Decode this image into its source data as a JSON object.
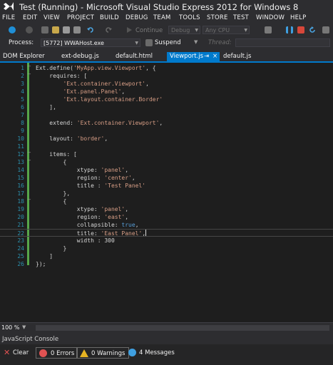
{
  "window": {
    "title": "Test (Running) - Microsoft Visual Studio Express 2012 for Windows 8"
  },
  "menu": [
    "FILE",
    "EDIT",
    "VIEW",
    "PROJECT",
    "BUILD",
    "DEBUG",
    "TEAM",
    "TOOLS",
    "STORE",
    "TEST",
    "WINDOW",
    "HELP"
  ],
  "toolbar": {
    "continue_label": "Continue",
    "config_value": "Debug",
    "platform_value": "Any CPU"
  },
  "debug_bar": {
    "process_label": "Process:",
    "process_value": "[5772] WWAHost.exe",
    "suspend_label": "Suspend",
    "thread_label": "Thread:"
  },
  "tabs": [
    {
      "label": "DOM Explorer"
    },
    {
      "label": "ext-debug.js"
    },
    {
      "label": "default.html"
    },
    {
      "label": "Viewport.js",
      "pin": "⇥",
      "close": "×"
    },
    {
      "label": "default.js"
    }
  ],
  "editor": {
    "lines": [
      {
        "n": "1",
        "text": "Ext.define('MyApp.view.Viewport', {"
      },
      {
        "n": "2",
        "text": "    requires: ["
      },
      {
        "n": "3",
        "text": "        'Ext.container.Viewport',"
      },
      {
        "n": "4",
        "text": "        'Ext.panel.Panel',"
      },
      {
        "n": "5",
        "text": "        'Ext.layout.container.Border'"
      },
      {
        "n": "6",
        "text": "    ],"
      },
      {
        "n": "7",
        "text": ""
      },
      {
        "n": "8",
        "text": "    extend: 'Ext.container.Viewport',"
      },
      {
        "n": "9",
        "text": ""
      },
      {
        "n": "10",
        "text": "    layout: 'border',"
      },
      {
        "n": "11",
        "text": ""
      },
      {
        "n": "12",
        "text": "    items: ["
      },
      {
        "n": "13",
        "text": "        {"
      },
      {
        "n": "14",
        "text": "            xtype: 'panel',"
      },
      {
        "n": "15",
        "text": "            region: 'center',"
      },
      {
        "n": "16",
        "text": "            title : 'Test Panel'"
      },
      {
        "n": "17",
        "text": "        },"
      },
      {
        "n": "18",
        "text": "        {"
      },
      {
        "n": "19",
        "text": "            xtype: 'panel',"
      },
      {
        "n": "20",
        "text": "            region: 'east',"
      },
      {
        "n": "21",
        "text": "            collapsible: true,"
      },
      {
        "n": "22",
        "text": "            title: 'East Panel',"
      },
      {
        "n": "23",
        "text": "            width : 300"
      },
      {
        "n": "24",
        "text": "        }"
      },
      {
        "n": "25",
        "text": "    ]"
      },
      {
        "n": "26",
        "text": "});"
      }
    ]
  },
  "status": {
    "zoom": "100 %"
  },
  "console": {
    "title": "JavaScript Console",
    "clear_label": "Clear",
    "errors_label": "0 Errors",
    "warnings_label": "0 Warnings",
    "messages_label": "4 Messages"
  },
  "colors": {
    "accent": "#007acc",
    "background": "#1e1e1e",
    "chrome": "#2d2d30",
    "line_number": "#2b91af",
    "string": "#d69d85",
    "keyword": "#569cd6",
    "changed_margin": "#57a64a"
  },
  "icons": [
    "vs-logo-icon",
    "back-icon",
    "forward-icon",
    "new-project-icon",
    "open-icon",
    "save-icon",
    "save-all-icon",
    "undo-icon",
    "redo-icon",
    "continue-icon",
    "pause-icon",
    "stop-icon",
    "restart-icon",
    "clear-icon",
    "error-icon",
    "warning-icon",
    "message-icon"
  ]
}
